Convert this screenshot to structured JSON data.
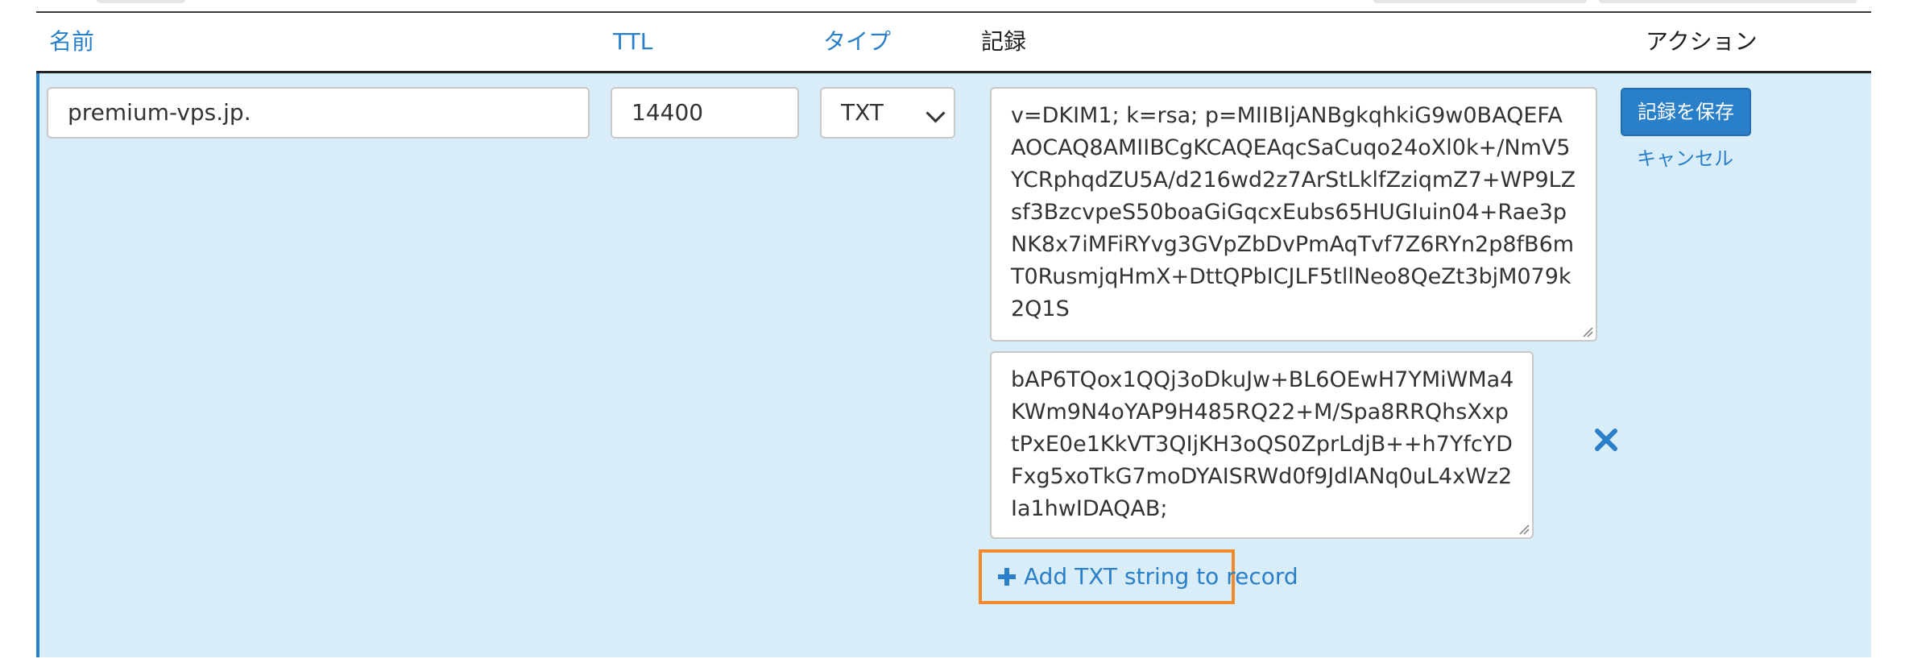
{
  "table": {
    "headers": {
      "name": "名前",
      "ttl": "TTL",
      "type": "タイプ",
      "record": "記録",
      "actions": "アクション"
    }
  },
  "edit_row": {
    "name_value": "premium-vps.jp.",
    "ttl_value": "14400",
    "type_selected": "TXT",
    "txt_strings": [
      "v=DKIM1; k=rsa; p=MIIBIjANBgkqhkiG9w0BAQEFAAOCAQ8AMIIBCgKCAQEAqcSaCuqo24oXl0k+/NmV5YCRphqdZU5A/d216wd2z7ArStLklfZziqmZ7+WP9LZsf3BzcvpeS50boaGiGqcxEubs65HUGIuin04+Rae3pNK8x7iMFiRYvg3GVpZbDvPmAqTvf7Z6RYn2p8fB6mT0RusmjqHmX+DttQPbICJLF5tllNeo8QeZt3bjM079k2Q1S",
      "bAP6TQox1QQj3oDkuJw+BL6OEwH7YMiWMa4KWm9N4oYAP9H485RQ22+M/Spa8RRQhsXxptPxE0e1KkVT3QIjKH3oQS0ZprLdjB++h7YfcYDFxg5xoTkG7moDYAISRWd0f9JdlANq0uL4xWz2Ia1hwIDAQAB;"
    ],
    "add_txt_label": "Add TXT string to record",
    "save_label": "記録を保存",
    "cancel_label": "キャンセル"
  },
  "icons": {
    "remove": "close-icon",
    "add": "plus-icon",
    "select": "chevron-down-icon"
  },
  "colors": {
    "link": "#2a7fc9",
    "row_bg": "#d9edf8",
    "highlight": "#f08a2c"
  }
}
